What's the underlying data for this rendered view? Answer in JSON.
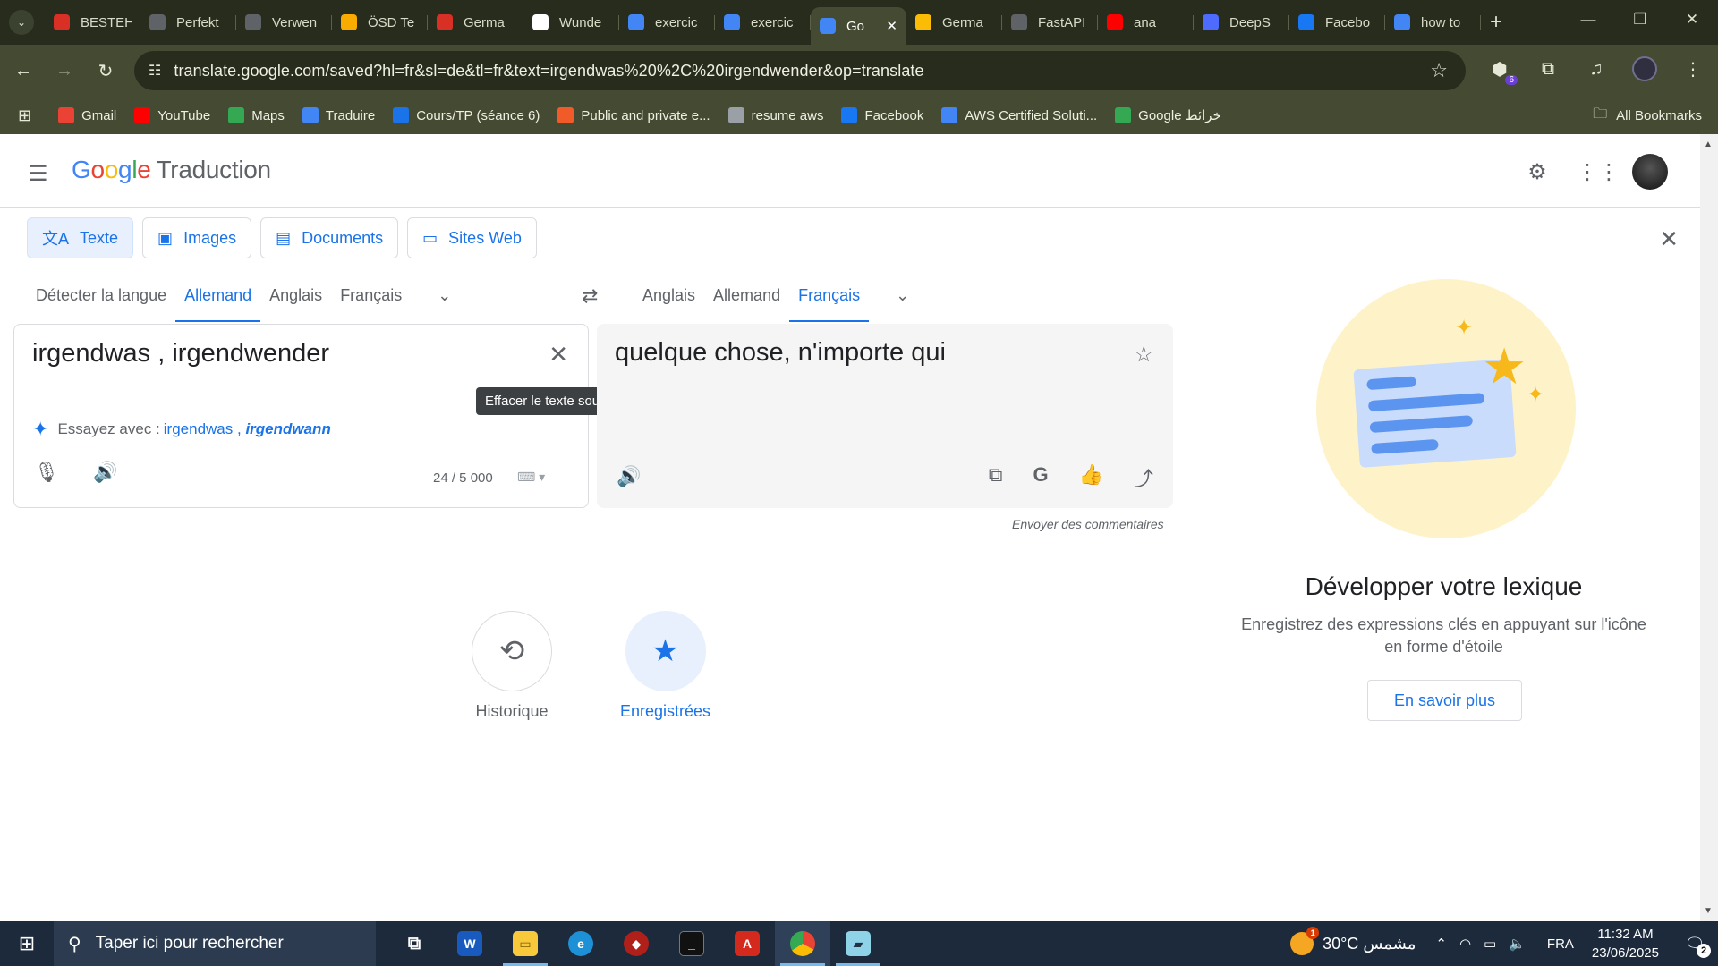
{
  "browser": {
    "tabs": [
      {
        "title": "BESTEH",
        "icon": "gemini-g-icon",
        "color": "#d93025"
      },
      {
        "title": "Perfekt",
        "icon": "openai-icon",
        "color": "#5f6368"
      },
      {
        "title": "Verwen",
        "icon": "openai-icon",
        "color": "#5f6368"
      },
      {
        "title": "ÖSD Te",
        "icon": "osd-icon",
        "color": "#f9ab00"
      },
      {
        "title": "Germa",
        "icon": "red-check-icon",
        "color": "#d93025"
      },
      {
        "title": "Wunde",
        "icon": "w-icon",
        "color": "#ffffff"
      },
      {
        "title": "exercic",
        "icon": "google-icon",
        "color": "#4285f4"
      },
      {
        "title": "exercic",
        "icon": "google-icon",
        "color": "#4285f4"
      },
      {
        "title": "Go",
        "icon": "google-translate-icon",
        "color": "#4285f4"
      },
      {
        "title": "Germa",
        "icon": "pencil-icon",
        "color": "#fbbc05"
      },
      {
        "title": "FastAPI",
        "icon": "openai-icon",
        "color": "#5f6368"
      },
      {
        "title": "ana",
        "icon": "youtube-icon",
        "color": "#ff0000"
      },
      {
        "title": "DeepS",
        "icon": "deepseek-icon",
        "color": "#4d6bfe"
      },
      {
        "title": "Facebo",
        "icon": "facebook-icon",
        "color": "#1877f2"
      },
      {
        "title": "how to",
        "icon": "google-icon",
        "color": "#4285f4"
      }
    ],
    "active_tab_index": 8,
    "url": "translate.google.com/saved?hl=fr&sl=de&tl=fr&text=irgendwas%20%2C%20irgendwender&op=translate",
    "extension_badge": "6",
    "bookmarks": [
      {
        "label": "Gmail",
        "icon": "gmail-icon",
        "color": "#ea4335"
      },
      {
        "label": "YouTube",
        "icon": "youtube-icon",
        "color": "#ff0000"
      },
      {
        "label": "Maps",
        "icon": "maps-icon",
        "color": "#34a853"
      },
      {
        "label": "Traduire",
        "icon": "google-translate-icon",
        "color": "#4285f4"
      },
      {
        "label": "Cours/TP (séance 6)",
        "icon": "classroom-icon",
        "color": "#1a73e8"
      },
      {
        "label": "Public and private e...",
        "icon": "pluralsight-icon",
        "color": "#f15b2a"
      },
      {
        "label": "resume aws",
        "icon": "globe-icon",
        "color": "#9aa0a6"
      },
      {
        "label": "Facebook",
        "icon": "facebook-icon",
        "color": "#1877f2"
      },
      {
        "label": "AWS Certified Soluti...",
        "icon": "udemy-icon",
        "color": "#4285f4"
      },
      {
        "label": "Google خرائط",
        "icon": "maps-icon",
        "color": "#34a853"
      }
    ],
    "all_bookmarks": "All Bookmarks"
  },
  "app": {
    "logo_google": "Google",
    "logo_product": "Traduction",
    "modes": [
      {
        "label": "Texte",
        "icon": "translate-icon"
      },
      {
        "label": "Images",
        "icon": "image-icon"
      },
      {
        "label": "Documents",
        "icon": "document-icon"
      },
      {
        "label": "Sites Web",
        "icon": "website-icon"
      }
    ],
    "source_langs": [
      "Détecter la langue",
      "Allemand",
      "Anglais",
      "Français"
    ],
    "source_selected": "Allemand",
    "target_langs": [
      "Anglais",
      "Allemand",
      "Français"
    ],
    "target_selected": "Français",
    "source_text": "irgendwas , irgendwender",
    "try_prefix": "Essayez avec : ",
    "try_plain": "irgendwas , ",
    "try_bold": "irgendwann",
    "char_count": "24 / 5 000",
    "tooltip": "Effacer le texte source",
    "translation": "quelque chose, n'importe qui",
    "feedback": "Envoyer des commentaires",
    "history_label": "Historique",
    "saved_label": "Enregistrées"
  },
  "side_panel": {
    "title": "Développer votre lexique",
    "description": "Enregistrez des expressions clés en appuyant sur l'icône en forme d'étoile",
    "button": "En savoir plus"
  },
  "taskbar": {
    "search_placeholder": "Taper ici pour rechercher",
    "weather": "30°C  مشمس",
    "weather_badge": "1",
    "language": "FRA",
    "time": "11:32 AM",
    "date": "23/06/2025",
    "notifications": "2"
  }
}
